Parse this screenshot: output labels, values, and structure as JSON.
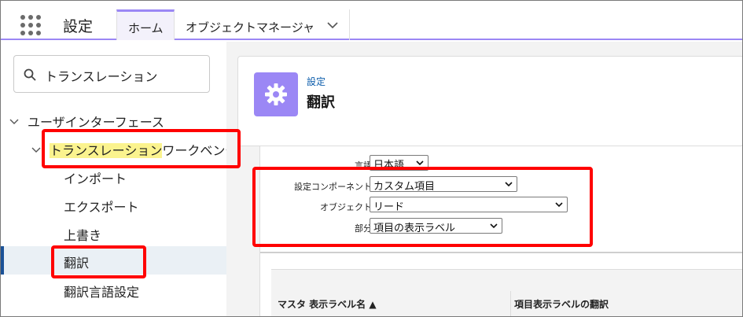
{
  "header": {
    "app_name": "設定",
    "tabs": [
      {
        "label": "ホーム"
      },
      {
        "label": "オブジェクトマネージャ"
      }
    ]
  },
  "sidebar": {
    "search_value": "トランスレーション",
    "items": [
      {
        "label": "ユーザインターフェース"
      },
      {
        "label_highlight": "トランスレーション",
        "label_rest": "ワークベンチ"
      },
      {
        "label": "インポート"
      },
      {
        "label": "エクスポート"
      },
      {
        "label": "上書き"
      },
      {
        "label": "翻訳"
      },
      {
        "label": "翻訳言語設定"
      }
    ]
  },
  "page": {
    "breadcrumb": "設定",
    "title": "翻訳"
  },
  "form": {
    "language": {
      "label": "言語",
      "value": "日本語"
    },
    "component": {
      "label": "設定コンポーネント",
      "value": "カスタム項目"
    },
    "object": {
      "label": "オブジェクト",
      "value": "リード"
    },
    "aspect": {
      "label": "部分",
      "value": "項目の表示ラベル"
    }
  },
  "table": {
    "columns": [
      "マスタ 表示ラベル名 ▲",
      "項目表示ラベルの翻訳"
    ]
  },
  "colors": {
    "accent": "#9b87f5",
    "annotation": "#ff0000",
    "highlight": "#fbf38e",
    "selected_bar": "#1b5297"
  }
}
